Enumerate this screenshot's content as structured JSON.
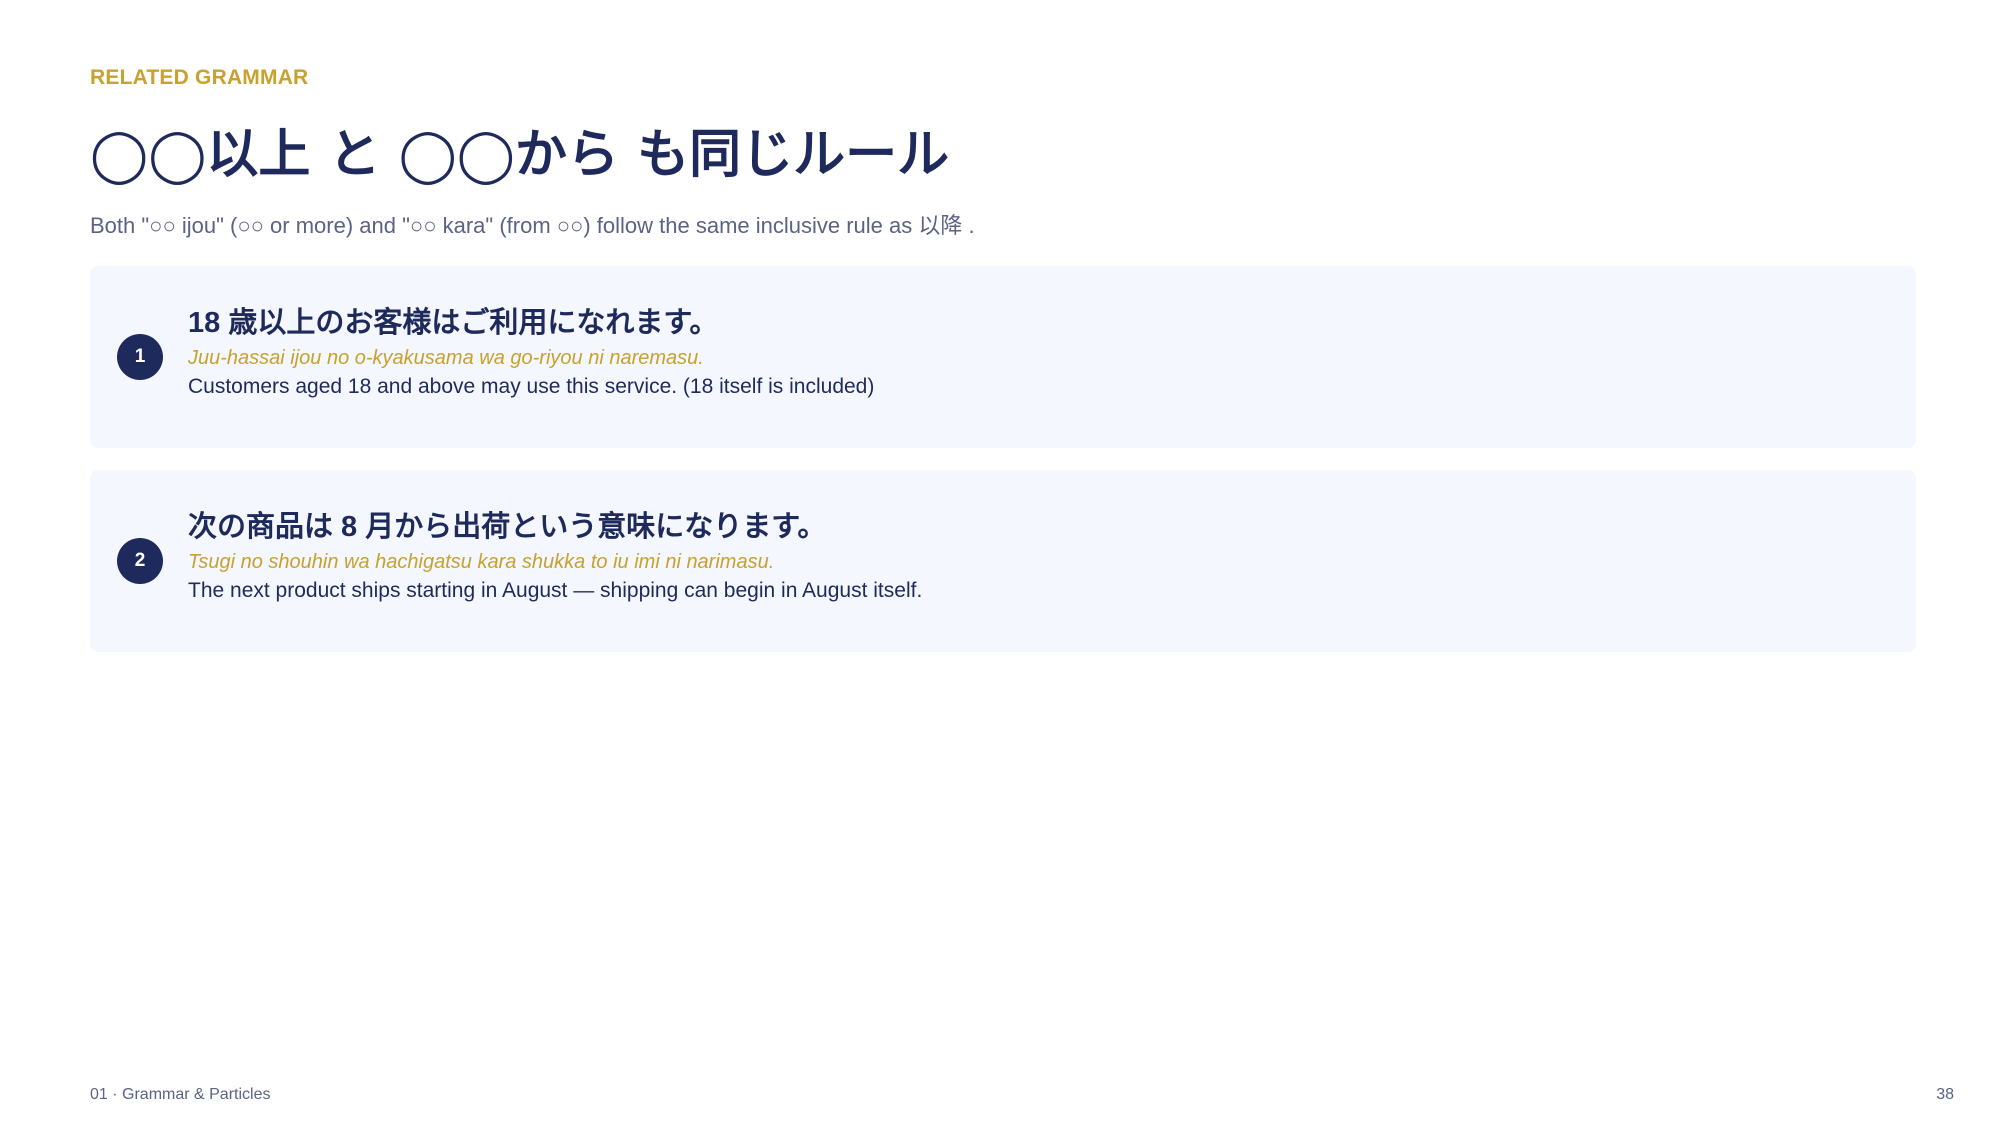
{
  "header": {
    "eyebrow": "RELATED GRAMMAR",
    "title": "◯◯以上 と ◯◯から も同じルール",
    "subtitle": "Both \"○○ ijou\" (○○ or more) and \"○○ kara\" (from ○○) follow the same inclusive rule as  以降 ."
  },
  "examples": [
    {
      "number": "1",
      "japanese": "18 歳以上のお客様はご利用になれます。",
      "romaji": "Juu-hassai ijou no o-kyakusama wa go-riyou ni naremasu.",
      "english": "Customers aged 18 and above may use this service. (18 itself is included)"
    },
    {
      "number": "2",
      "japanese": "次の商品は 8 月から出荷という意味になります。",
      "romaji": "Tsugi no shouhin wa hachigatsu kara shukka to iu imi ni narimasu.",
      "english": "The next product ships starting in August — shipping can begin in August itself."
    }
  ],
  "footer": {
    "section": "01 · Grammar & Particles",
    "page_number": "38"
  },
  "colors": {
    "accent": "#c8a12e",
    "navy": "#1f2a5c",
    "card_background": "#f4f7fd",
    "muted_text": "#5a6385"
  }
}
